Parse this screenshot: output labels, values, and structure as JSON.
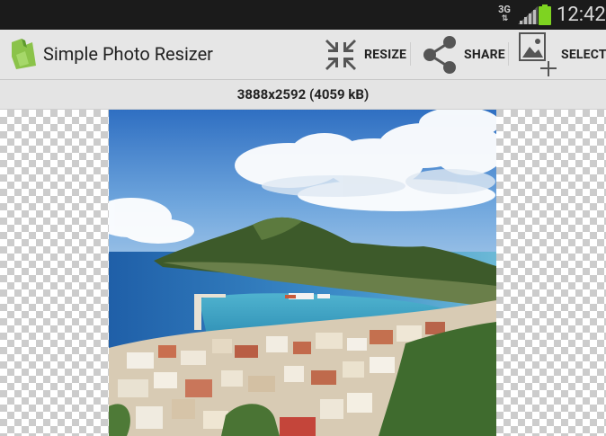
{
  "status": {
    "network": "3G",
    "time": "12:42",
    "battery_color": "#7ed321"
  },
  "app": {
    "title": "Simple Photo Resizer",
    "icon": "app-photo-icon"
  },
  "actions": {
    "resize": "RESIZE",
    "share": "SHARE",
    "select": "SELECT"
  },
  "image_info": {
    "dimensions_text": "3888x2592 (4059 kB)"
  },
  "colors": {
    "actionbar_bg": "#e6e6e6",
    "statusbar_bg": "#1b1b1b",
    "icon_gray": "#555555",
    "app_green": "#8bc34a"
  }
}
